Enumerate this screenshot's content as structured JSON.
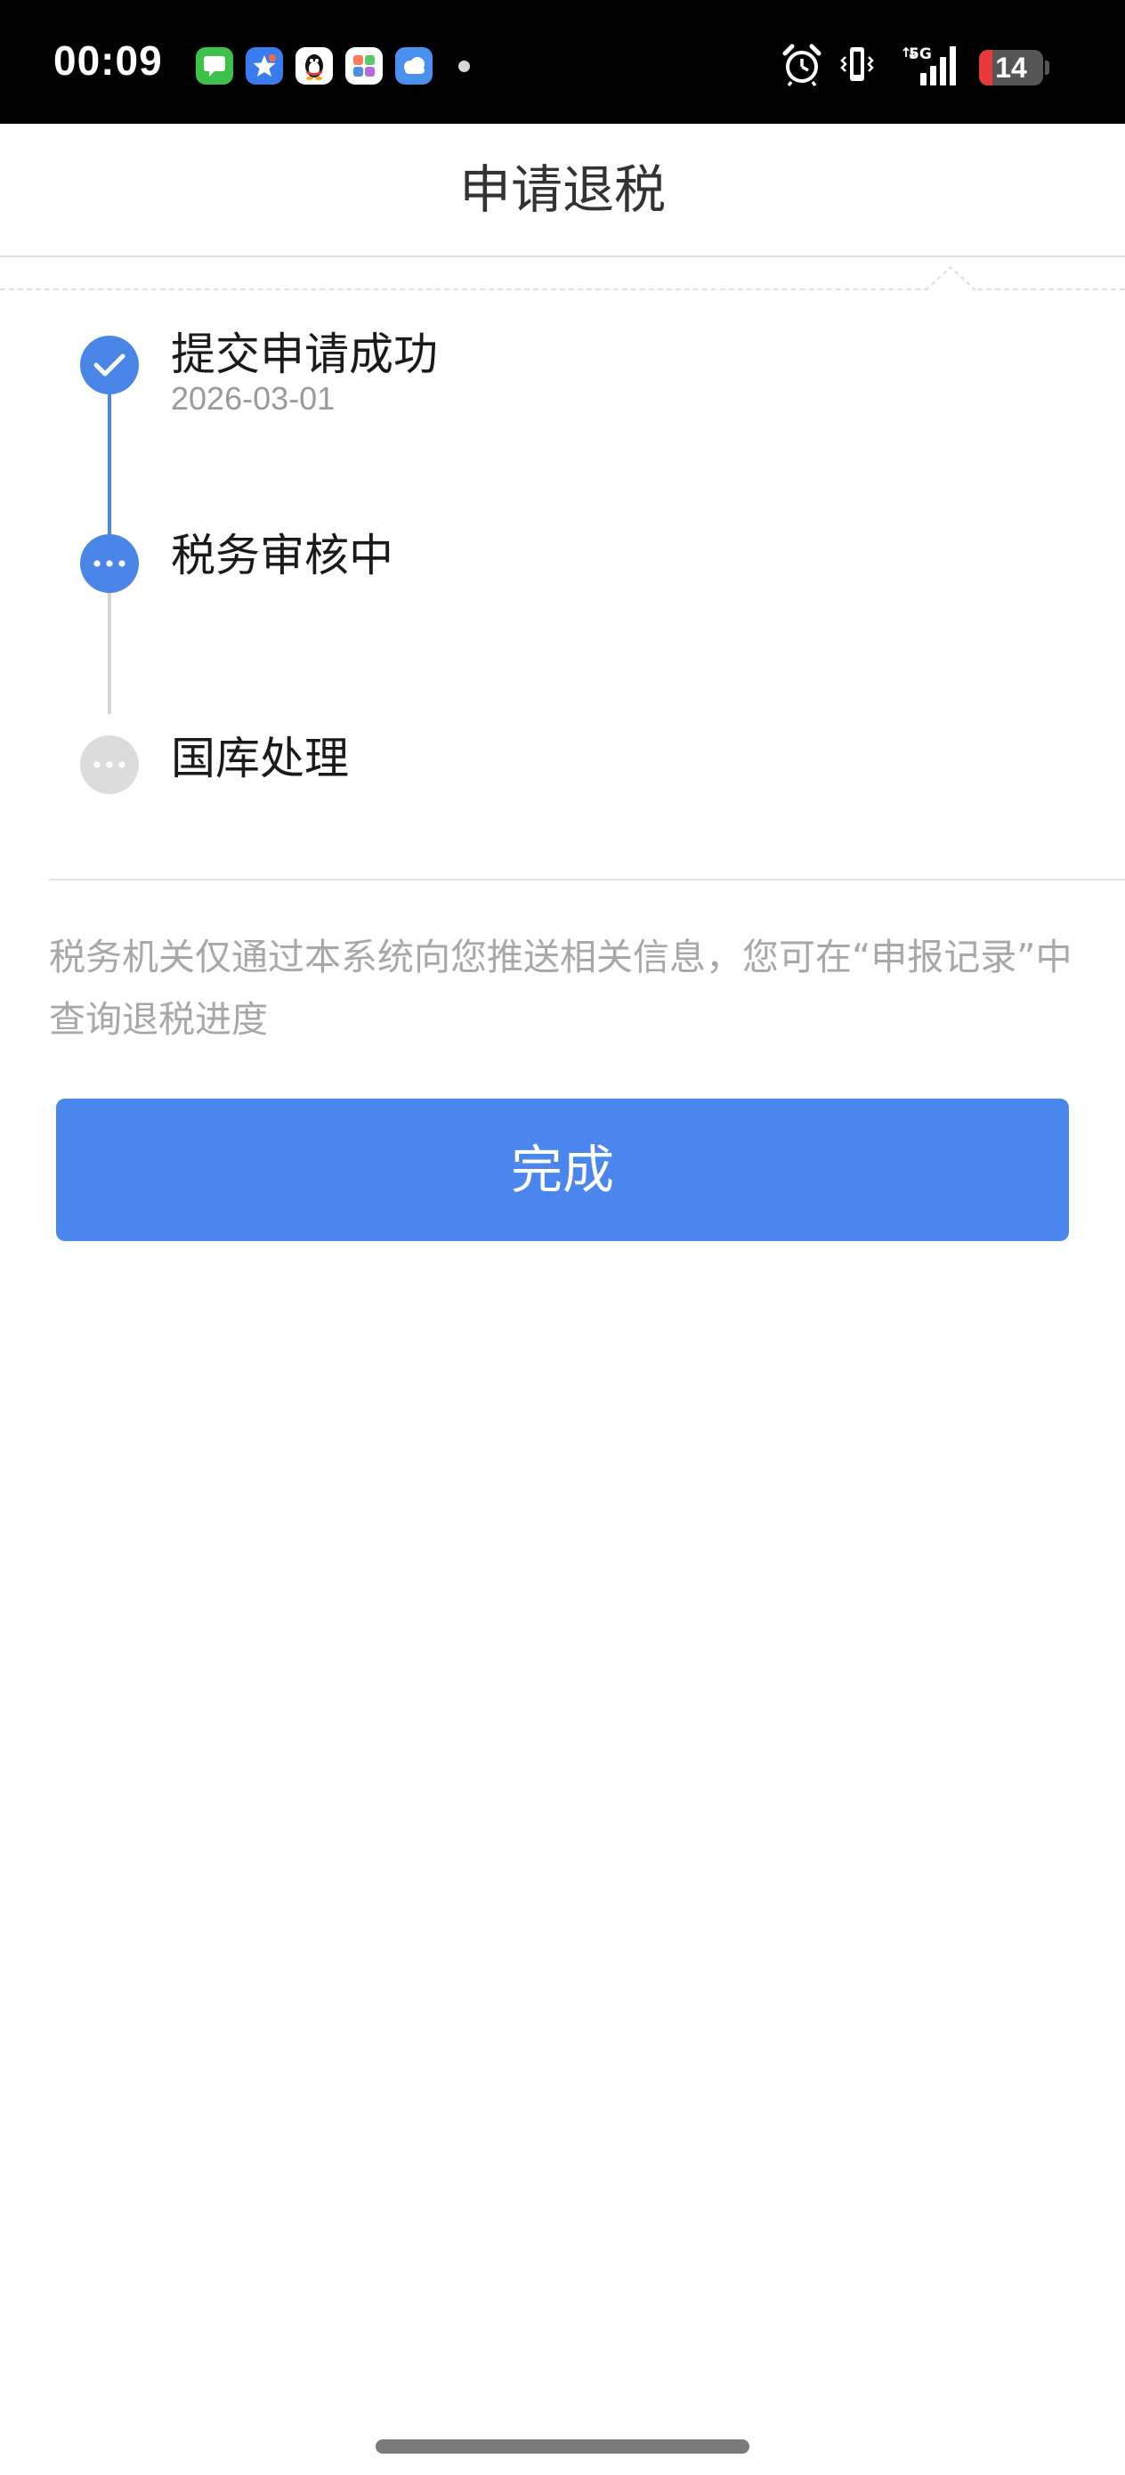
{
  "status_bar": {
    "time": "00:09",
    "network": "5G",
    "battery_level": "14",
    "battery_fraction": 0.14,
    "app_icons": [
      "messages-icon",
      "star-app-icon",
      "qq-penguin-icon",
      "gallery-icon",
      "weather-icon"
    ],
    "system_icons": [
      "alarm-icon",
      "vibrate-icon",
      "signal-icon",
      "battery-icon"
    ]
  },
  "header": {
    "title": "申请退税"
  },
  "timeline": {
    "steps": [
      {
        "label": "提交申请成功",
        "date": "2026-03-01",
        "state": "done",
        "icon": "check-icon"
      },
      {
        "label": "税务审核中",
        "state": "active",
        "icon": "more-dots-icon"
      },
      {
        "label": "国库处理",
        "state": "pending",
        "icon": "more-dots-icon"
      }
    ]
  },
  "notice": {
    "text": "税务机关仅通过本系统向您推送相关信息，您可在“申报记录”中查询退税进度"
  },
  "actions": {
    "done_label": "完成"
  },
  "colors": {
    "accent": "#4a86ee",
    "pending": "#dcdcdc",
    "muted_text": "#a8a8a8",
    "battery_low": "#e83a3a"
  }
}
